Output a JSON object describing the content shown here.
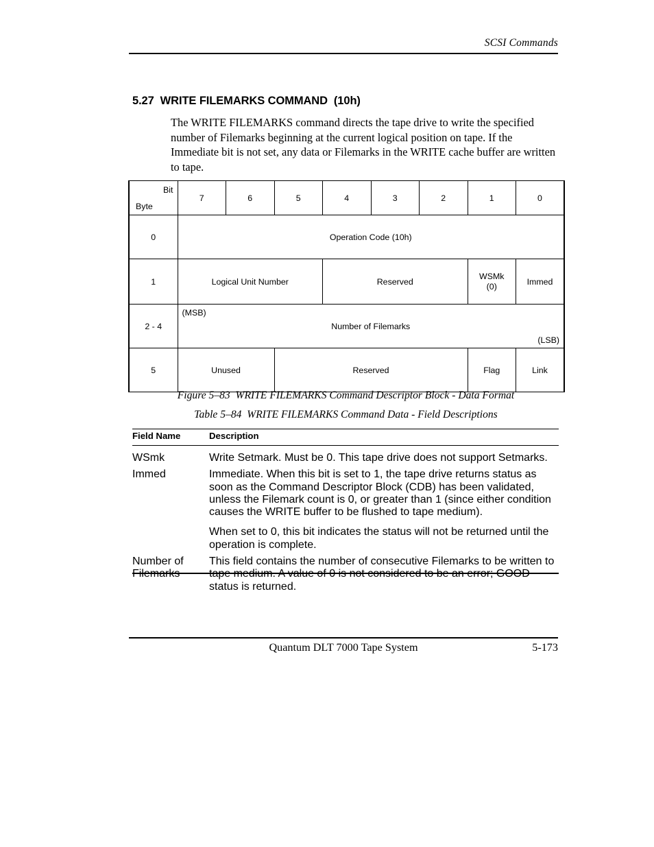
{
  "running_head": "SCSI Commands",
  "section": {
    "heading": "5.27  WRITE FILEMARKS COMMAND  (10h)",
    "intro": "The WRITE FILEMARKS command directs the tape drive to write the specified number of Filemarks beginning at the current logical position on tape. If the Immediate bit is not set, any data or Filemarks in the WRITE cache buffer are written to tape."
  },
  "cdb_table": {
    "corner": {
      "bit_label": "Bit",
      "byte_label": "Byte"
    },
    "bit_headers": [
      "7",
      "6",
      "5",
      "4",
      "3",
      "2",
      "1",
      "0"
    ],
    "rows": [
      {
        "byte": "0",
        "cells": [
          {
            "text": "Operation Code (10h)",
            "span": 8
          }
        ]
      },
      {
        "byte": "1",
        "cells": [
          {
            "text": "Logical Unit Number",
            "span": 3
          },
          {
            "text": "Reserved",
            "span": 3
          },
          {
            "text": "WSMk",
            "text2": "(0)",
            "span": 1
          },
          {
            "text": "Immed",
            "span": 1
          }
        ]
      },
      {
        "byte": "2 - 4",
        "msb": "(MSB)",
        "lsb": "(LSB)",
        "cells": [
          {
            "text": "Number of Filemarks",
            "span": 8
          }
        ]
      },
      {
        "byte": "5",
        "cells": [
          {
            "text": "Unused",
            "span": 2
          },
          {
            "text": "Reserved",
            "span": 4
          },
          {
            "text": "Flag",
            "span": 1
          },
          {
            "text": "Link",
            "span": 1
          }
        ]
      }
    ]
  },
  "figure_caption": "Figure 5–83  WRITE FILEMARKS Command Descriptor Block - Data Format",
  "table_caption": "Table 5–84  WRITE FILEMARKS Command Data - Field Descriptions",
  "field_table": {
    "headers": {
      "name": "Field Name",
      "description": "Description"
    },
    "rows": [
      {
        "name": "WSmk",
        "paragraphs": [
          "Write Setmark. Must be 0. This tape drive does not support Setmarks."
        ]
      },
      {
        "name": "Immed",
        "paragraphs": [
          "Immediate. When this bit is set to 1, the tape drive returns status as soon as the Command Descriptor Block (CDB) has been validated, unless the Filemark count is 0, or greater than 1 (since either condition causes the WRITE buffer to be flushed to tape medium).",
          "When set to 0, this bit indicates the status will not be returned until the operation is complete."
        ]
      },
      {
        "name": "Number of",
        "name2": "Filemarks",
        "paragraphs": [
          "This field contains the number of consecutive Filemarks to be written to tape medium. A value of 0 is not considered to be an error; GOOD status is returned."
        ]
      }
    ]
  },
  "footer": {
    "center": "Quantum DLT 7000 Tape System",
    "page_number": "5-173"
  }
}
